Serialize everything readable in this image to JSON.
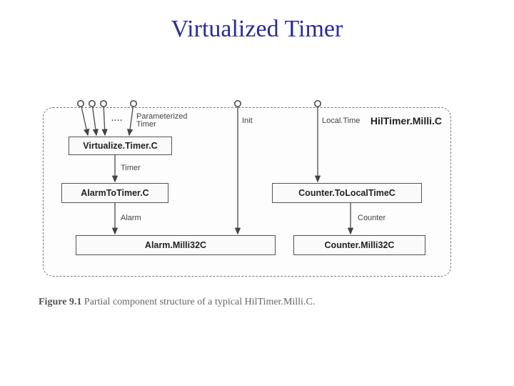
{
  "title": "Virtualized Timer",
  "container_label": "HilTimer.Milli.C",
  "components": {
    "virtualize": "Virtualize.Timer.C",
    "alarm_to_timer": "AlarmToTimer.C",
    "alarm_milli": "Alarm.Milli32C",
    "counter_to_local": "Counter.ToLocalTimeC",
    "counter_milli": "Counter.Milli32C"
  },
  "edges": {
    "param_timer": "Parameterized Timer",
    "init": "Init",
    "local_time": "Local.Time",
    "timer": "Timer",
    "alarm": "Alarm",
    "counter": "Counter"
  },
  "dots": "....",
  "caption_prefix": "Figure 9.1",
  "caption_text": "Partial component structure of a typical HilTimer.Milli.C."
}
